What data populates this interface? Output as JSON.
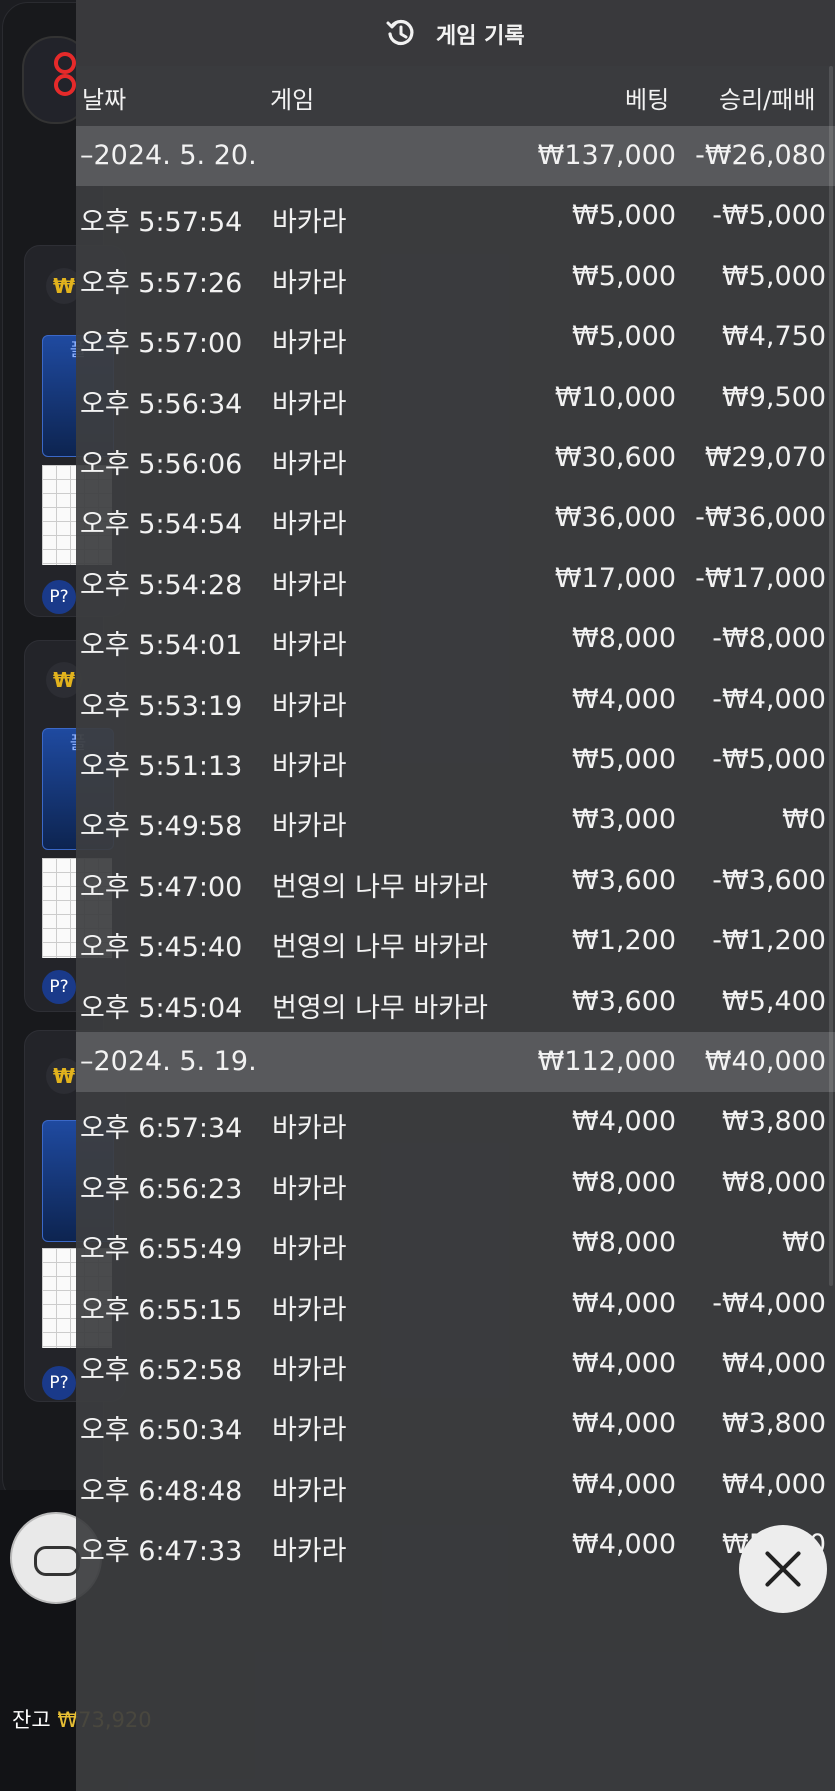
{
  "header": {
    "title": "게임 기록",
    "icon": "history-icon"
  },
  "columns": {
    "date": "날짜",
    "game": "게임",
    "bet": "베팅",
    "result": "승리/패배"
  },
  "groups": [
    {
      "date": "–2024. 5. 20.",
      "bet_total": "₩137,000",
      "result_total": "-₩26,080",
      "rows": [
        {
          "time": "오후 5:57:54",
          "game": "바카라",
          "bet": "₩5,000",
          "result": "-₩5,000"
        },
        {
          "time": "오후 5:57:26",
          "game": "바카라",
          "bet": "₩5,000",
          "result": "₩5,000"
        },
        {
          "time": "오후 5:57:00",
          "game": "바카라",
          "bet": "₩5,000",
          "result": "₩4,750"
        },
        {
          "time": "오후 5:56:34",
          "game": "바카라",
          "bet": "₩10,000",
          "result": "₩9,500"
        },
        {
          "time": "오후 5:56:06",
          "game": "바카라",
          "bet": "₩30,600",
          "result": "₩29,070"
        },
        {
          "time": "오후 5:54:54",
          "game": "바카라",
          "bet": "₩36,000",
          "result": "-₩36,000"
        },
        {
          "time": "오후 5:54:28",
          "game": "바카라",
          "bet": "₩17,000",
          "result": "-₩17,000"
        },
        {
          "time": "오후 5:54:01",
          "game": "바카라",
          "bet": "₩8,000",
          "result": "-₩8,000"
        },
        {
          "time": "오후 5:53:19",
          "game": "바카라",
          "bet": "₩4,000",
          "result": "-₩4,000"
        },
        {
          "time": "오후 5:51:13",
          "game": "바카라",
          "bet": "₩5,000",
          "result": "-₩5,000"
        },
        {
          "time": "오후 5:49:58",
          "game": "바카라",
          "bet": "₩3,000",
          "result": "₩0"
        },
        {
          "time": "오후 5:47:00",
          "game": "번영의 나무 바카라",
          "bet": "₩3,600",
          "result": "-₩3,600"
        },
        {
          "time": "오후 5:45:40",
          "game": "번영의 나무 바카라",
          "bet": "₩1,200",
          "result": "-₩1,200"
        },
        {
          "time": "오후 5:45:04",
          "game": "번영의 나무 바카라",
          "bet": "₩3,600",
          "result": "₩5,400"
        }
      ]
    },
    {
      "date": "–2024. 5. 19.",
      "bet_total": "₩112,000",
      "result_total": "₩40,000",
      "rows": [
        {
          "time": "오후 6:57:34",
          "game": "바카라",
          "bet": "₩4,000",
          "result": "₩3,800"
        },
        {
          "time": "오후 6:56:23",
          "game": "바카라",
          "bet": "₩8,000",
          "result": "₩8,000"
        },
        {
          "time": "오후 6:55:49",
          "game": "바카라",
          "bet": "₩8,000",
          "result": "₩0"
        },
        {
          "time": "오후 6:55:15",
          "game": "바카라",
          "bet": "₩4,000",
          "result": "-₩4,000"
        },
        {
          "time": "오후 6:52:58",
          "game": "바카라",
          "bet": "₩4,000",
          "result": "₩4,000"
        },
        {
          "time": "오후 6:50:34",
          "game": "바카라",
          "bet": "₩4,000",
          "result": "₩3,800"
        },
        {
          "time": "오후 6:48:48",
          "game": "바카라",
          "bet": "₩4,000",
          "result": "₩4,000"
        },
        {
          "time": "오후 6:47:33",
          "game": "바카라",
          "bet": "₩4,000",
          "result": "₩5,000"
        }
      ]
    }
  ],
  "background": {
    "balance_label": "잔고",
    "balance_value": "₩73,920",
    "card_coin": "₩",
    "card_label": "플",
    "p_badge": "P?"
  },
  "close_button": {
    "icon": "close-icon"
  }
}
